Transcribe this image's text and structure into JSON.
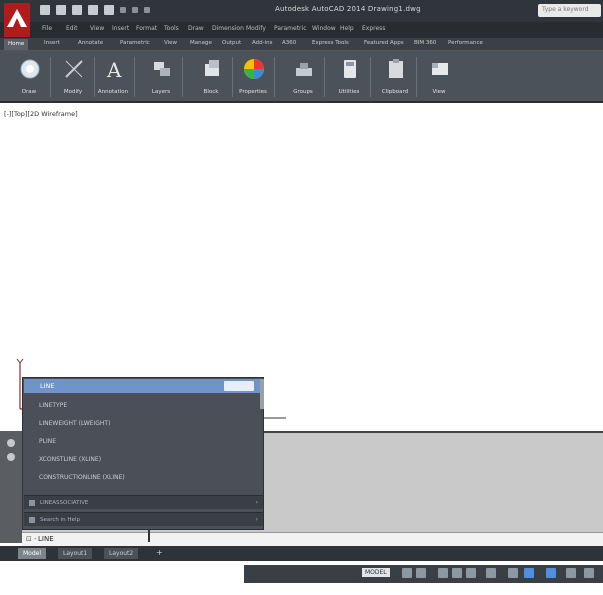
{
  "window": {
    "title": "Autodesk AutoCAD 2014   Drawing1.dwg",
    "search_placeholder": "Type a keyword"
  },
  "menu": [
    {
      "label": "File",
      "slot": 1
    },
    {
      "label": "Edit",
      "slot": 2
    },
    {
      "label": "View",
      "slot": 3
    },
    {
      "label": "Insert",
      "slot": 4
    },
    {
      "label": "Format",
      "slot": 5
    },
    {
      "label": "Tools",
      "slot": 6
    },
    {
      "label": "Draw",
      "slot": 7
    },
    {
      "label": "Dimension",
      "slot": 8
    },
    {
      "label": "Modify",
      "slot": 9
    },
    {
      "label": "Parametric",
      "slot": 10
    },
    {
      "label": "Window",
      "slot": 11
    },
    {
      "label": "Help",
      "slot": 12
    },
    {
      "label": "Express",
      "slot": 13
    }
  ],
  "ribbon_tabs": [
    "Home",
    "Insert",
    "Annotate",
    "Parametric",
    "View",
    "Manage",
    "Output",
    "Add-ins",
    "A360",
    "Express Tools",
    "Featured Apps",
    "BIM 360",
    "Performance"
  ],
  "ribbon_panels": [
    {
      "label": "Draw",
      "icon": "draw-circle-icon"
    },
    {
      "label": "Modify",
      "icon": "modify-icon"
    },
    {
      "label": "Annotation",
      "icon": "annotation-icon"
    },
    {
      "label": "Layers",
      "icon": "layers-icon"
    },
    {
      "label": "Block",
      "icon": "block-icon"
    },
    {
      "label": "Properties",
      "icon": "properties-icon"
    },
    {
      "label": "Groups",
      "icon": "groups-icon"
    },
    {
      "label": "Utilities",
      "icon": "utilities-icon"
    },
    {
      "label": "Clipboard",
      "icon": "clipboard-icon"
    },
    {
      "label": "View",
      "icon": "view-icon"
    }
  ],
  "viewport": {
    "label": "[-][Top][2D Wireframe]"
  },
  "autocomplete": {
    "selected": "LINE",
    "selected_tag": "",
    "items": [
      "LINETYPE",
      "LINEWEIGHT (LWEIGHT)",
      "PLINE",
      "XCONSTLINE (XLINE)",
      "CONSTRUCTIONLINE (XLINE)"
    ],
    "sections": [
      "LINEASSOCIATIVE",
      "Search in Help"
    ]
  },
  "command_line": {
    "text": "LINE"
  },
  "layout_tabs": [
    "Model",
    "Layout1",
    "Layout2"
  ],
  "status": {
    "coords": "",
    "model_label": "MODEL"
  },
  "colors": {
    "accent": "#6e94c8",
    "app_red": "#b01c1c"
  }
}
